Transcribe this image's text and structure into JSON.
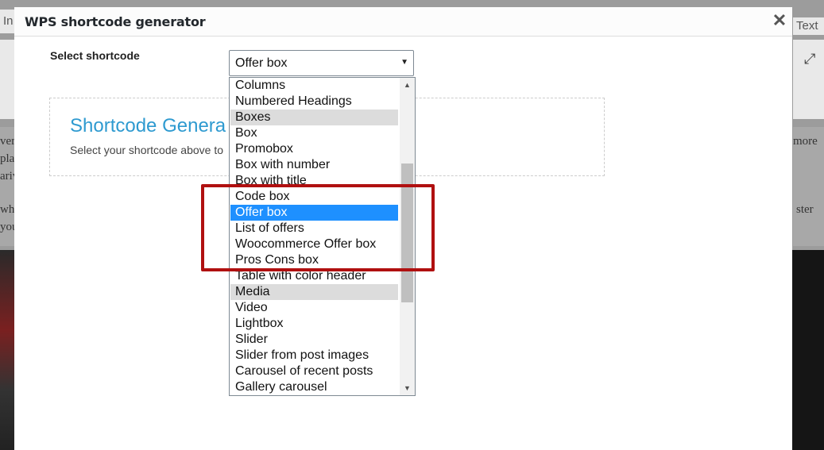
{
  "background": {
    "tab_left_text": "In",
    "tab_right_text": "Text",
    "left_text_lines": [
      "ver",
      "pla",
      "ariv",
      "wha",
      "you"
    ],
    "right_text_lines": [
      "more",
      "ster"
    ]
  },
  "modal": {
    "title": "WPS shortcode generator",
    "close_icon": "close-icon",
    "select_label": "Select shortcode",
    "select_value": "Offer box",
    "generator_title": "Shortcode Genera",
    "generator_subtitle": "Select your shortcode above to"
  },
  "dropdown": {
    "options": [
      {
        "label": "Columns",
        "type": "option"
      },
      {
        "label": "Numbered Headings",
        "type": "option"
      },
      {
        "label": "Boxes",
        "type": "group"
      },
      {
        "label": "Box",
        "type": "option"
      },
      {
        "label": "Promobox",
        "type": "option"
      },
      {
        "label": "Box with number",
        "type": "option"
      },
      {
        "label": "Box with title",
        "type": "option"
      },
      {
        "label": "Code box",
        "type": "option"
      },
      {
        "label": "Offer box",
        "type": "selected"
      },
      {
        "label": "List of offers",
        "type": "option"
      },
      {
        "label": "Woocommerce Offer box",
        "type": "option"
      },
      {
        "label": "Pros Cons box",
        "type": "option"
      },
      {
        "label": "Table with color header",
        "type": "option"
      },
      {
        "label": "Media",
        "type": "group"
      },
      {
        "label": "Video",
        "type": "option"
      },
      {
        "label": "Lightbox",
        "type": "option"
      },
      {
        "label": "Slider",
        "type": "option"
      },
      {
        "label": "Slider from post images",
        "type": "option"
      },
      {
        "label": "Carousel of recent posts",
        "type": "option"
      },
      {
        "label": "Gallery carousel",
        "type": "option"
      }
    ]
  },
  "colors": {
    "selected_bg": "#1e90ff",
    "group_bg": "#dcdcdc",
    "highlight": "#b01010",
    "title_blue": "#2e9ad0"
  }
}
